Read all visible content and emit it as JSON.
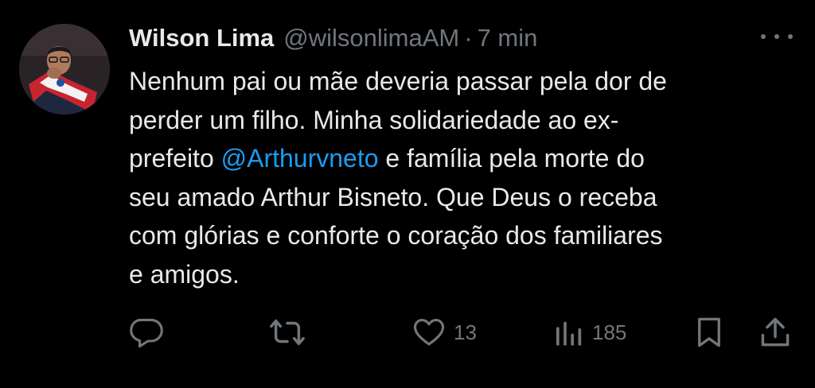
{
  "author": {
    "display_name": "Wilson Lima",
    "handle": "@wilsonlimaAM",
    "separator": "·",
    "time": "7 min"
  },
  "tweet": {
    "lines": [
      {
        "before": "Nenhum pai ou mãe deveria passar pela dor de"
      },
      {
        "before": "perder um filho. Minha solidariedade ao ex-"
      },
      {
        "before": "prefeito ",
        "mention": "@Arthurvneto",
        "after": " e família pela morte do"
      },
      {
        "before": "seu amado Arthur Bisneto. Que Deus o receba"
      },
      {
        "before": "com glórias e conforte o coração dos familiares"
      },
      {
        "before": "e amigos."
      }
    ]
  },
  "actions": {
    "reply_icon": "reply-icon",
    "retweet_icon": "retweet-icon",
    "like_icon": "heart-icon",
    "like_count": "13",
    "views_icon": "analytics-icon",
    "views_count": "185",
    "bookmark_icon": "bookmark-icon",
    "share_icon": "share-icon"
  },
  "colors": {
    "background": "#000000",
    "text": "#e7e9ea",
    "secondary": "#71767b",
    "mention": "#1d9bf0"
  }
}
